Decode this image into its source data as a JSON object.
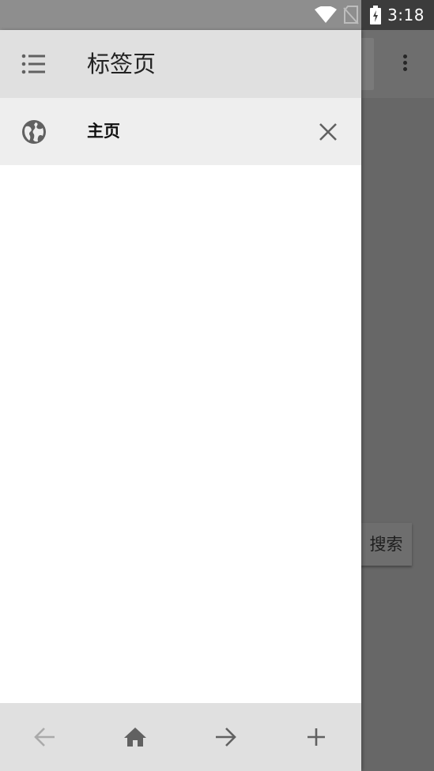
{
  "status_bar": {
    "time": "3:18",
    "icons": [
      "wifi-icon",
      "no-sim-icon",
      "battery-charging-icon"
    ]
  },
  "drawer": {
    "title": "标签页",
    "header_icon": "list-icon",
    "tabs": [
      {
        "title": "主页",
        "icon": "globe-icon",
        "close_icon": "close-icon"
      }
    ],
    "bottom_bar": {
      "buttons": [
        "back-arrow-icon",
        "home-icon",
        "forward-arrow-icon",
        "add-icon"
      ]
    }
  },
  "background_page": {
    "search_button_label": "搜索",
    "menu_icon": "more-vert-icon"
  },
  "colors": {
    "status_bar": "#8e8e8e",
    "drawer_header": "#e0e0e0",
    "tab_item": "#eeeeee",
    "bottom_bar": "#e0e0e0",
    "scrim": "#676767"
  }
}
